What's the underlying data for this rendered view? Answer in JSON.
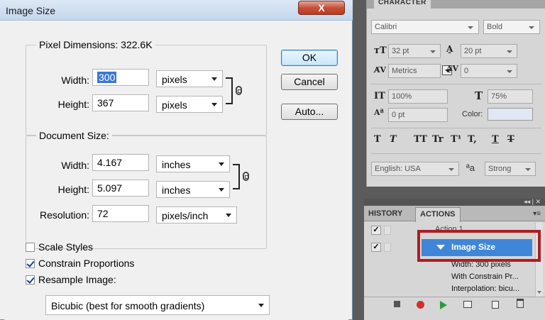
{
  "dialog": {
    "title": "Image Size",
    "close_glyph": "X",
    "pixel_dimensions": {
      "legend": "Pixel Dimensions:",
      "size_value": "322.6K",
      "width_label": "Width:",
      "width_value": "300",
      "width_unit": "pixels",
      "height_label": "Height:",
      "height_value": "367",
      "height_unit": "pixels"
    },
    "document_size": {
      "legend": "Document Size:",
      "width_label": "Width:",
      "width_value": "4.167",
      "width_unit": "inches",
      "height_label": "Height:",
      "height_value": "5.097",
      "height_unit": "inches",
      "resolution_label": "Resolution:",
      "resolution_value": "72",
      "resolution_unit": "pixels/inch"
    },
    "buttons": {
      "ok": "OK",
      "cancel": "Cancel",
      "auto": "Auto..."
    },
    "options": {
      "scale_styles": {
        "label": "Scale Styles",
        "checked": false
      },
      "constrain_proportions": {
        "label": "Constrain Proportions",
        "checked": true
      },
      "resample_image": {
        "label": "Resample Image:",
        "checked": true
      }
    },
    "resample_method": "Bicubic (best for smooth gradients)"
  },
  "character_panel": {
    "tab_label": "CHARACTER",
    "font_family": "Calibri",
    "font_style": "Bold",
    "font_size": "32 pt",
    "leading": "20 pt",
    "kerning": "Metrics",
    "tracking": "0",
    "vertical_scale": "100%",
    "horizontal_scale": "75%",
    "baseline_shift": "0 pt",
    "color_label": "Color:",
    "style_buttons": [
      "T",
      "T",
      "TT",
      "Tr",
      "T¹",
      "T,",
      "T",
      "T"
    ],
    "language": "English: USA",
    "aa_glyph": "ªa",
    "antialias": "Strong"
  },
  "actions_panel": {
    "header_controls": "◂◂ | ✕",
    "tabs": [
      "HISTORY",
      "ACTIONS"
    ],
    "active_tab": "ACTIONS",
    "rows": [
      {
        "text": "Action 1",
        "checked": true
      },
      {
        "text": "Image Size",
        "checked": true,
        "selected": true
      },
      {
        "text": "Width: 300 pixels"
      },
      {
        "text": "With Constrain Pr..."
      },
      {
        "text": "Interpolation: bicu..."
      }
    ]
  },
  "colors": {
    "titlebar": "#c4d7ec",
    "close_button": "#c7503a",
    "selection_blue": "#3f86d8",
    "highlight_red": "#b01d22",
    "record_red": "#d62d2d",
    "play_green": "#2e9a3b"
  }
}
